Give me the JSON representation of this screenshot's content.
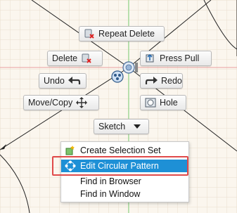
{
  "marking_menu": {
    "repeat_delete": "Repeat Delete",
    "delete": "Delete",
    "press_pull": "Press Pull",
    "undo": "Undo",
    "redo": "Redo",
    "move_copy": "Move/Copy",
    "hole": "Hole",
    "sketch": "Sketch"
  },
  "context_menu": {
    "items": [
      {
        "label": "Create Selection Set",
        "icon": "selection-set-icon",
        "highlighted": false
      },
      {
        "label": "Edit Circular Pattern",
        "icon": "circular-pattern-icon",
        "highlighted": true
      },
      {
        "label": "Find in Browser",
        "icon": "",
        "highlighted": false
      },
      {
        "label": "Find in Window",
        "icon": "",
        "highlighted": false
      }
    ]
  },
  "colors": {
    "background": "#fbf6ee",
    "grid": "#eadfcf",
    "axis_green": "#7dd67d",
    "axis_red": "#e8a0a0",
    "highlight": "#1e90d6",
    "annotation": "#e04a4a"
  }
}
